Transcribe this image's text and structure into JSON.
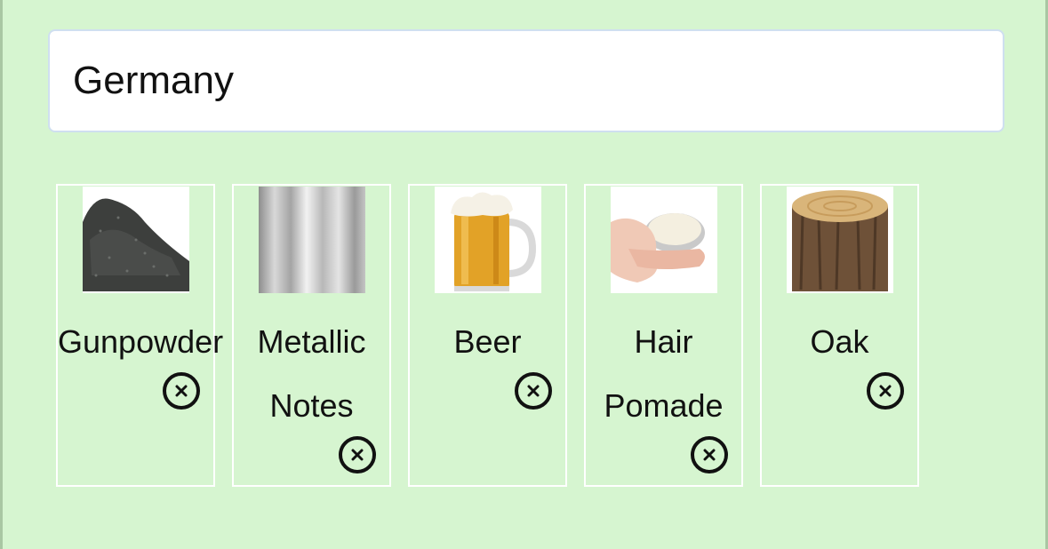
{
  "search": {
    "value": "Germany"
  },
  "items": [
    {
      "label": "Gunpowder",
      "image": "gunpowder"
    },
    {
      "label": "Metallic Notes",
      "image": "metallic"
    },
    {
      "label": "Beer",
      "image": "beer"
    },
    {
      "label": "Hair Pomade",
      "image": "hair-pomade"
    },
    {
      "label": "Oak",
      "image": "oak"
    }
  ],
  "colors": {
    "background": "#d6f5d0",
    "card_border": "#ffffff",
    "input_border": "#cfdff0"
  }
}
